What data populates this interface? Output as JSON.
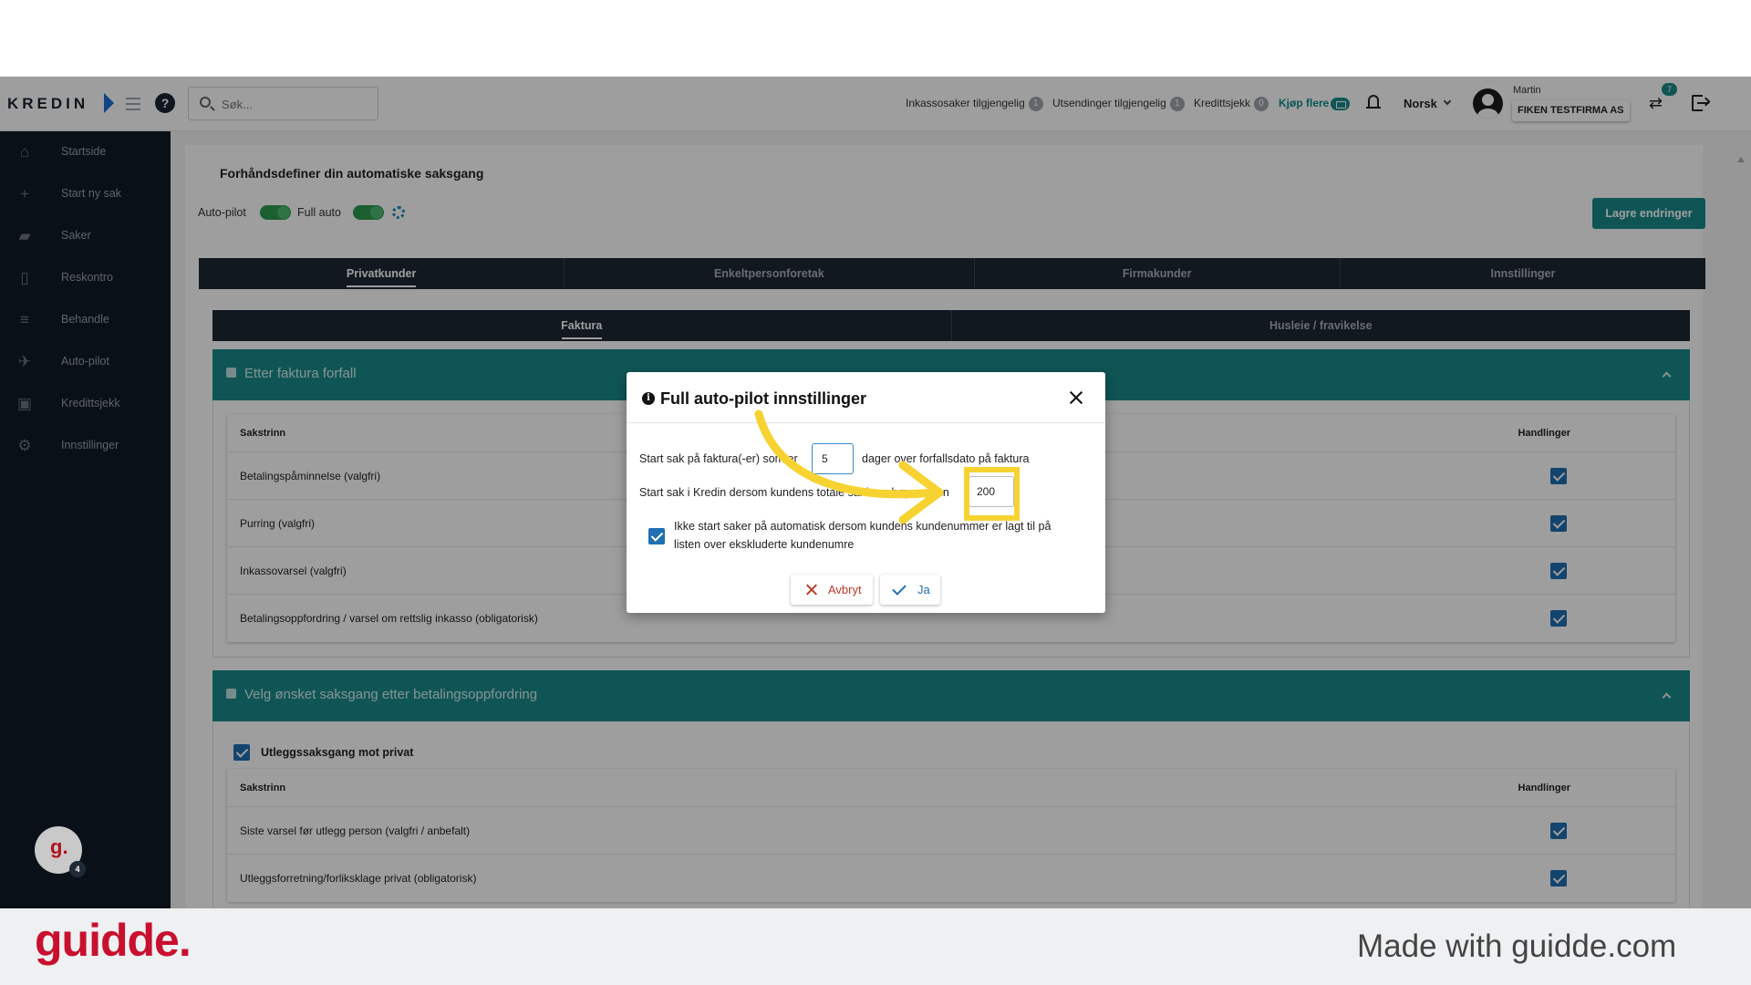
{
  "header": {
    "logo_text": "KREDIN",
    "search_placeholder": "Søk...",
    "quotas": [
      {
        "label": "Inkassosaker tilgjengelig",
        "count": "1"
      },
      {
        "label": "Utsendinger tilgjengelig",
        "count": "1"
      },
      {
        "label": "Kredittsjekk",
        "count": "0"
      }
    ],
    "buy_more": "Kjøp flere",
    "language": "Norsk",
    "user_name": "Martin",
    "company": "FIKEN TESTFIRMA AS",
    "swap_badge": "7"
  },
  "sidebar": {
    "items": [
      {
        "label": "Startside",
        "icon": "home-icon"
      },
      {
        "label": "Start ny sak",
        "icon": "plus-icon"
      },
      {
        "label": "Saker",
        "icon": "briefcase-icon"
      },
      {
        "label": "Reskontro",
        "icon": "document-icon"
      },
      {
        "label": "Behandle",
        "icon": "process-icon"
      },
      {
        "label": "Auto-pilot",
        "icon": "airplane-icon"
      },
      {
        "label": "Kredittsjekk",
        "icon": "id-card-icon"
      },
      {
        "label": "Innstillinger",
        "icon": "gear-icon"
      }
    ],
    "guidde_avatar_letter": "g.",
    "guidde_avatar_count": "4"
  },
  "page": {
    "title": "Forhåndsdefiner din automatiske saksgang",
    "toggle_autopilot": "Auto-pilot",
    "toggle_fullauto": "Full auto",
    "save_button": "Lagre endringer",
    "customer_tabs": [
      "Privatkunder",
      "Enkeltpersonforetak",
      "Firmakunder",
      "Innstillinger"
    ],
    "sub_tabs": [
      "Faktura",
      "Husleie / fravikelse"
    ],
    "section1": {
      "title": "Etter faktura forfall",
      "col_step": "Sakstrinn",
      "col_actions": "Handlinger",
      "rows": [
        "Betalingspåminnelse (valgfri)",
        "Purring (valgfri)",
        "Inkassovarsel (valgfri)",
        "Betalingsoppfordring / varsel om rettslig inkasso (obligatorisk)"
      ]
    },
    "section2": {
      "title": "Velg ønsket saksgang etter betalingsoppfordring",
      "checkbox_label": "Utleggssaksgang mot privat",
      "col_step": "Sakstrinn",
      "col_actions": "Handlinger",
      "rows": [
        "Siste varsel før utlegg person (valgfri / anbefalt)",
        "Utleggsforretning/forliksklage privat (obligatorisk)"
      ]
    }
  },
  "modal": {
    "title": "Full auto-pilot innstillinger",
    "line1_prefix": "Start sak på faktura(-er) som er",
    "line1_value": "5",
    "line1_suffix": "dager over forfallsdato på faktura",
    "line2_prefix": "Start sak i Kredin dersom kundens totale saldo er høyere enn",
    "line2_value": "200",
    "checkbox_text_1": "Ikke start saker på automatisk dersom kundens kundenummer er lagt til på",
    "checkbox_text_2": "listen over ekskluderte kundenumre",
    "cancel": "Avbryt",
    "confirm": "Ja"
  },
  "footer": {
    "logo": "guidde.",
    "tagline": "Made with guidde.com"
  },
  "colors": {
    "accent": "#1a8a8a",
    "sidebar": "#0f1a26",
    "checkbox": "#1f6fb2",
    "highlight": "#f6d330",
    "brand_red": "#c8102e"
  }
}
